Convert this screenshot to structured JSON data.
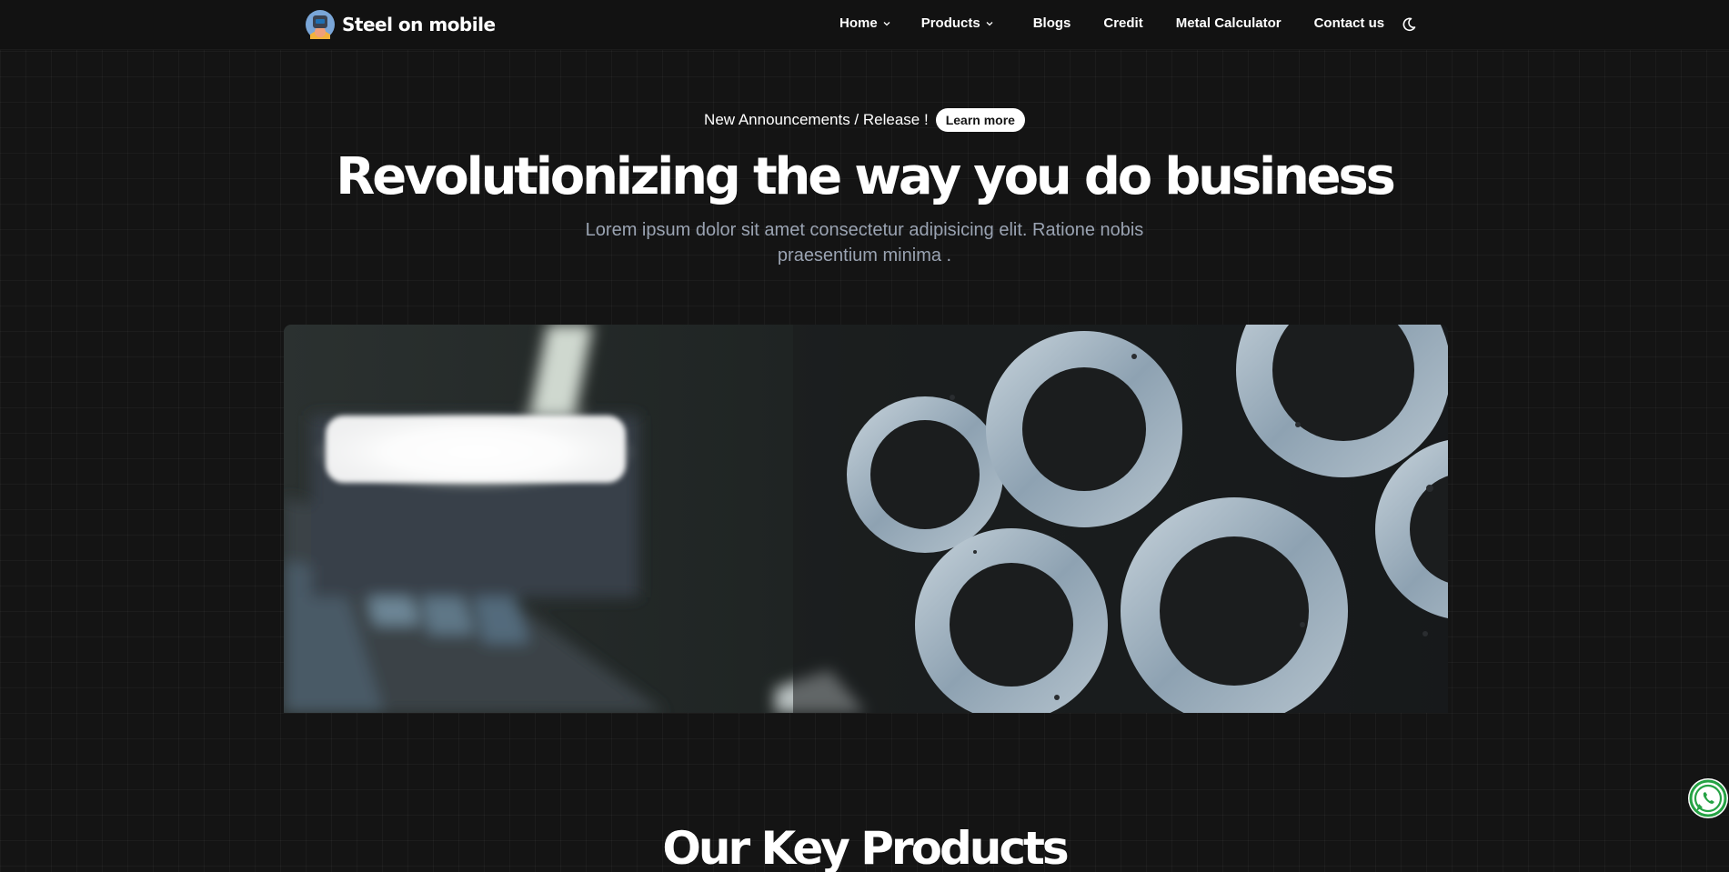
{
  "nav": {
    "brand": "Steel on mobile",
    "items": [
      {
        "label": "Home",
        "dropdown": true
      },
      {
        "label": "Products",
        "dropdown": true
      },
      {
        "label": "Blogs",
        "dropdown": false
      },
      {
        "label": "Credit",
        "dropdown": false
      },
      {
        "label": "Metal Calculator",
        "dropdown": false
      },
      {
        "label": "Contact us",
        "dropdown": false
      }
    ],
    "theme_icon": "moon-icon"
  },
  "hero": {
    "announcement": "New Announcements / Release !",
    "learn_more": "Learn more",
    "title": "Revolutionizing the way you do business",
    "subtitle": "Lorem ipsum dolor sit amet consectetur adipisicing elit. Ratione nobis praesentium minima ."
  },
  "sections": {
    "key_products_title": "Our Key Products"
  },
  "floating": {
    "whatsapp_icon": "whatsapp-icon"
  },
  "colors": {
    "background": "#141414",
    "navbar": "#121212",
    "subtitle": "#9aa3b2",
    "whatsapp": "#25a244"
  }
}
